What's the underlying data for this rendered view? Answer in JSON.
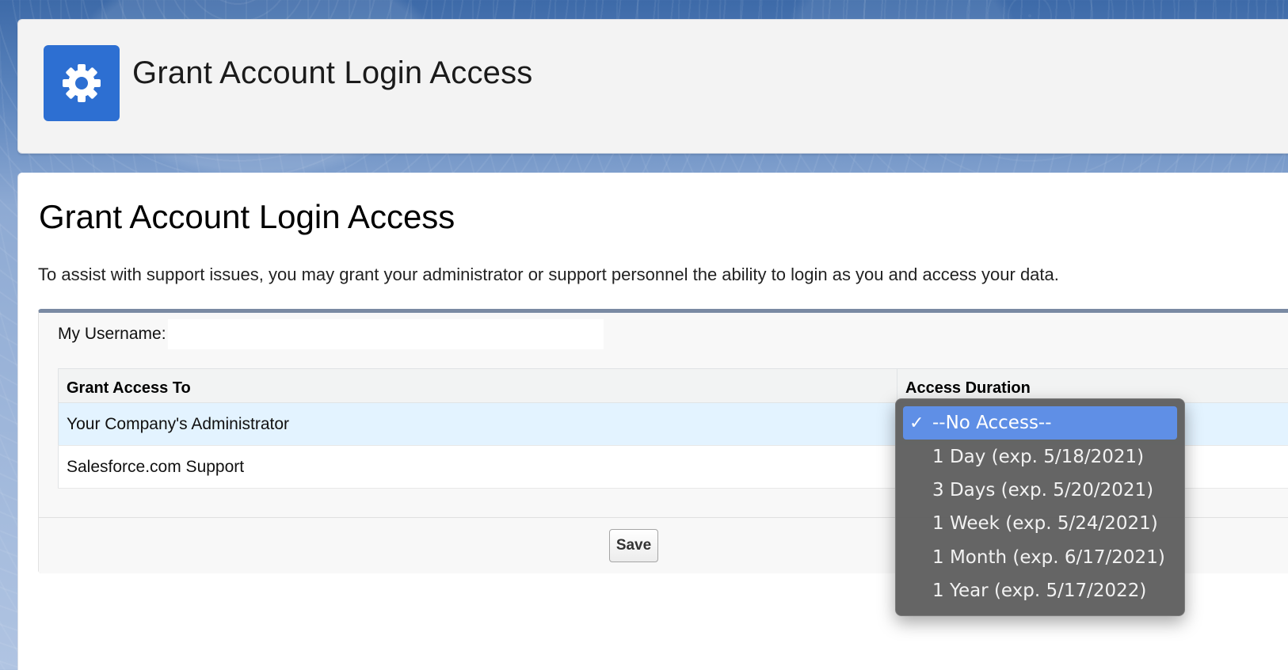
{
  "header": {
    "title": "Grant Account Login Access",
    "icon": "gear-icon",
    "icon_color": "#2d6fd2"
  },
  "main": {
    "heading": "Grant Account Login Access",
    "intro": "To assist with support issues, you may grant your administrator or support personnel the ability to login as you and access your data.",
    "username_label": "My Username:",
    "username_value": "",
    "table": {
      "headers": [
        "Grant Access To",
        "Access Duration"
      ],
      "rows": [
        {
          "name": "Your Company's Administrator"
        },
        {
          "name": "Salesforce.com Support"
        }
      ]
    },
    "save_label": "Save"
  },
  "dropdown": {
    "selected_index": 0,
    "check_glyph": "✓",
    "options": [
      "--No Access--",
      "1 Day (exp. 5/18/2021)",
      "3 Days (exp. 5/20/2021)",
      "1 Week (exp. 5/24/2021)",
      "1 Month (exp. 6/17/2021)",
      "1 Year (exp. 5/17/2022)"
    ]
  }
}
